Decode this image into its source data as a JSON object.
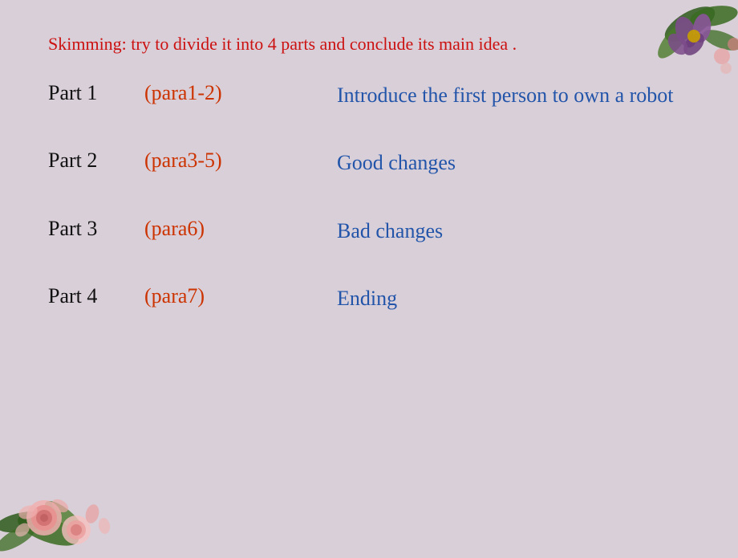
{
  "background_color": "#d9cfd8",
  "header": {
    "skimming_text": "Skimming: try to divide it into 4 parts and conclude its main idea ."
  },
  "parts": [
    {
      "label": "Part 1",
      "para": "(para1-2)",
      "description": "Introduce the first person to own a robot"
    },
    {
      "label": "Part 2",
      "para": "(para3-5)",
      "description": "Good changes"
    },
    {
      "label": "Part 3",
      "para": "(para6)",
      "description": "Bad changes"
    },
    {
      "label": "Part 4",
      "para": "(para7)",
      "description": "Ending"
    }
  ]
}
